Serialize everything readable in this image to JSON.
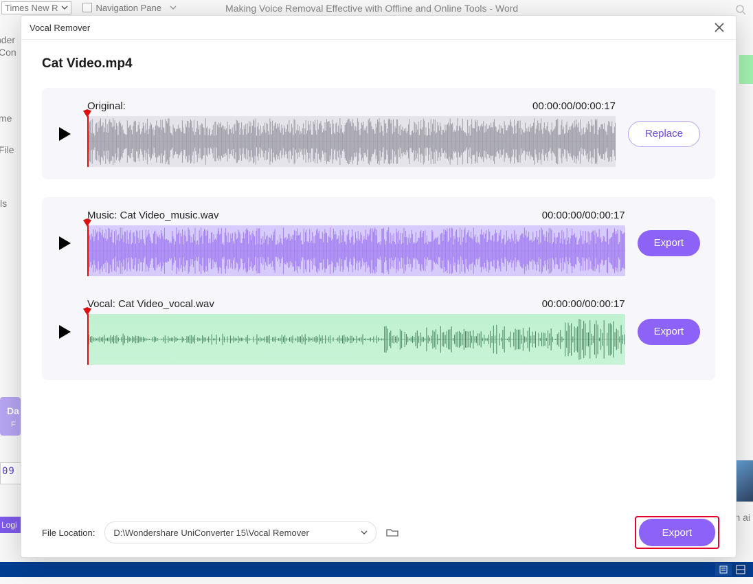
{
  "word": {
    "font": "Times New R",
    "nav_label": "Navigation Pane",
    "title": "Making Voice Removal Effective with Offline and Online Tools  -  Word",
    "frags": [
      "nder",
      "Con",
      "me",
      "File",
      "ls",
      "Da",
      "F",
      "Logi",
      "09",
      "m ai"
    ]
  },
  "dialog": {
    "title": "Vocal Remover",
    "file_title": "Cat Video.mp4",
    "tracks": [
      {
        "label": "Original:",
        "time": "00:00:00/00:00:17",
        "action": "Replace",
        "action_style": "outline",
        "wave_style": "grey",
        "wave_color": "#9a98a3",
        "density": "dense"
      },
      {
        "label": "Music: Cat Video_music.wav",
        "time": "00:00:00/00:00:17",
        "action": "Export",
        "action_style": "fill",
        "wave_style": "purple",
        "wave_color": "#a07bf1",
        "density": "dense"
      },
      {
        "label": "Vocal: Cat Video_vocal.wav",
        "time": "00:00:00/00:00:17",
        "action": "Export",
        "action_style": "fill",
        "wave_style": "green",
        "wave_color": "#3f7b58",
        "density": "sparse"
      }
    ],
    "footer": {
      "label": "File Location:",
      "path": "D:\\Wondershare UniConverter 15\\Vocal Remover",
      "export": "Export"
    }
  }
}
